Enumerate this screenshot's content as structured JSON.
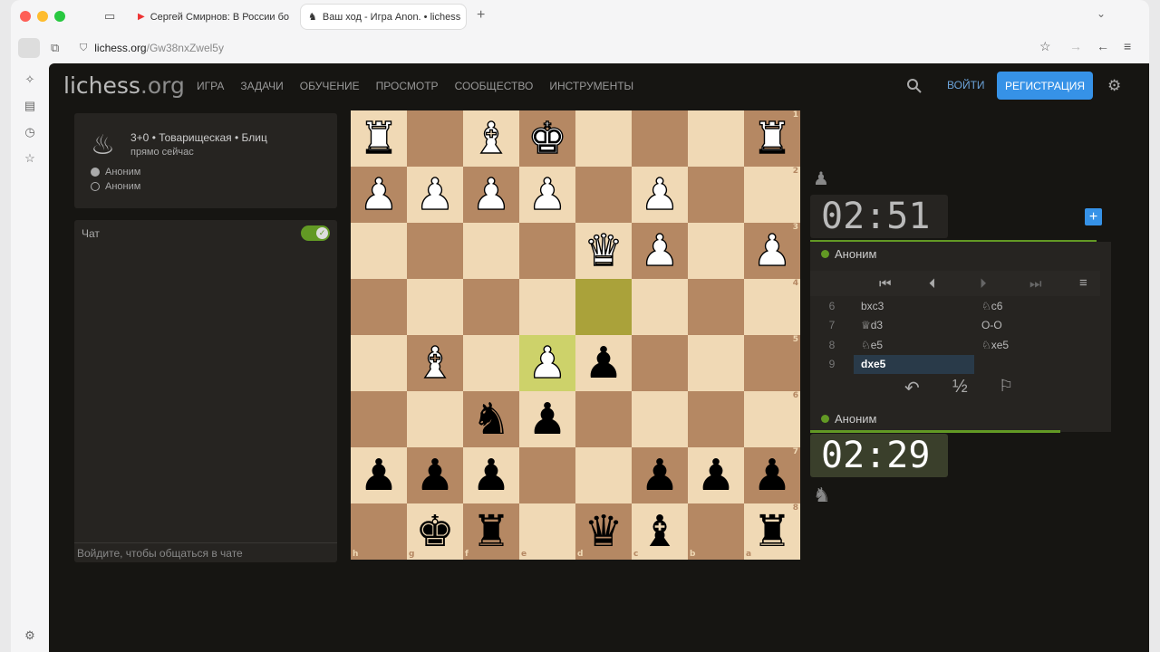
{
  "browser": {
    "tabs": [
      {
        "title": "Сергей Смирнов: В России бо"
      },
      {
        "title": "Ваш ход - Игра Anon. • lichess"
      }
    ],
    "url_host": "lichess.org",
    "url_path": "/Gw38nxZwel5y"
  },
  "site": {
    "logo": "lichess",
    "logo_suffix": ".org",
    "nav": [
      "ИГРА",
      "ЗАДАЧИ",
      "ОБУЧЕНИЕ",
      "ПРОСМОТР",
      "СООБЩЕСТВО",
      "ИНСТРУМЕНТЫ"
    ],
    "login": "ВОЙТИ",
    "register": "РЕГИСТРАЦИЯ"
  },
  "game": {
    "title": "3+0 • Товарищеская • Блиц",
    "time": "прямо сейчас",
    "player1": "Аноним",
    "player2": "Аноним"
  },
  "chat": {
    "label": "Чат",
    "placeholder": "Войдите, чтобы общаться в чате"
  },
  "clocks": {
    "top": "02:51",
    "bottom": "02:29",
    "top_player": "Аноним",
    "bottom_player": "Аноним"
  },
  "moves": [
    {
      "n": "6",
      "w": "bxc3",
      "b": "♘c6"
    },
    {
      "n": "7",
      "w": "♕d3",
      "b": "O-O"
    },
    {
      "n": "8",
      "w": "♘e5",
      "b": "♘xe5"
    },
    {
      "n": "9",
      "w": "dxe5",
      "b": ""
    }
  ],
  "board": {
    "ranks": [
      "1",
      "2",
      "3",
      "4",
      "5",
      "6",
      "7",
      "8"
    ],
    "files": [
      "h",
      "g",
      "f",
      "e",
      "d",
      "c",
      "b",
      "a"
    ]
  }
}
